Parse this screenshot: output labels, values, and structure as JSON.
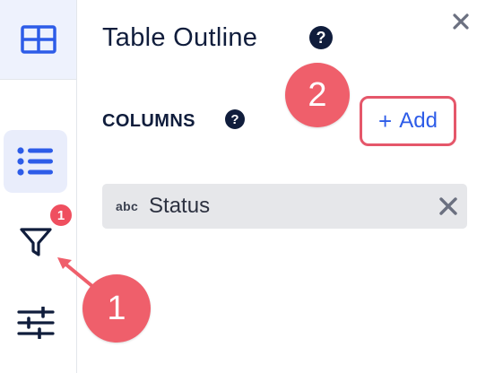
{
  "panel": {
    "title": "Table Outline",
    "columns_label": "COLUMNS",
    "add_label": "Add",
    "add_plus": "+"
  },
  "columns": [
    {
      "type_badge": "abc",
      "name": "Status"
    }
  ],
  "sidebar": {
    "filter_badge": "1",
    "items": [
      {
        "icon": "table-grid-icon",
        "active": true
      },
      {
        "icon": "list-icon",
        "selected": true
      },
      {
        "icon": "filter-icon"
      },
      {
        "icon": "sliders-icon"
      }
    ]
  },
  "annotations": {
    "marker_1": "1",
    "marker_2": "2"
  },
  "colors": {
    "accent": "#2d5ce8",
    "navy": "#101d3c",
    "marker": "#ef5f6b",
    "badge": "#ef4f5f",
    "chip_bg": "#e6e7ea"
  }
}
